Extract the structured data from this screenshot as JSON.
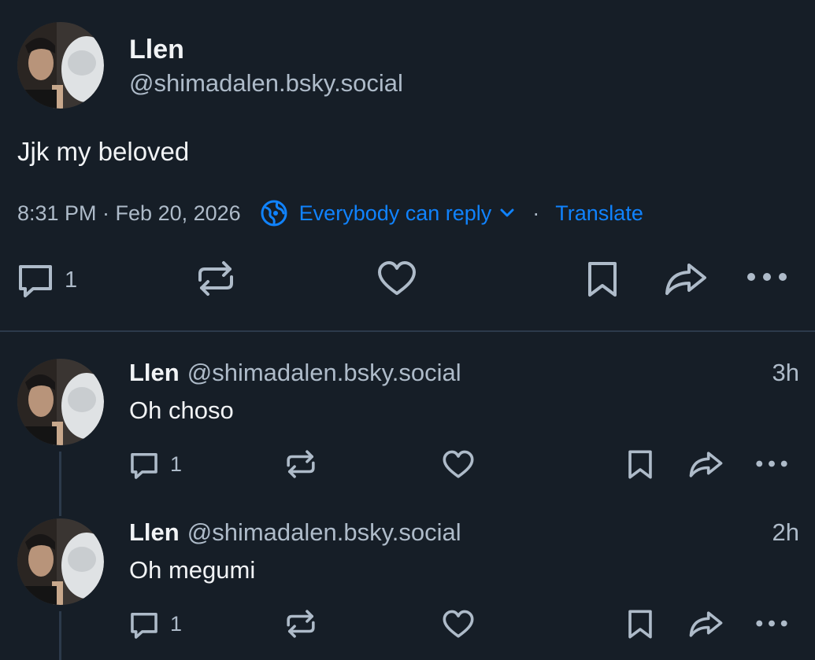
{
  "main_post": {
    "author_name": "Llen",
    "author_handle": "@shimadalen.bsky.social",
    "text": "Jjk my beloved",
    "timestamp": "8:31 PM · Feb 20, 2026",
    "reply_setting": "Everybody can reply",
    "separator": "·",
    "translate_label": "Translate",
    "reply_count": "1",
    "icons": [
      "reply-icon",
      "repost-icon",
      "like-icon",
      "bookmark-icon",
      "share-icon",
      "more-icon"
    ]
  },
  "replies": [
    {
      "author_name": "Llen",
      "author_handle": "@shimadalen.bsky.social",
      "time": "3h",
      "text": "Oh choso",
      "reply_count": "1"
    },
    {
      "author_name": "Llen",
      "author_handle": "@shimadalen.bsky.social",
      "time": "2h",
      "text": "Oh megumi",
      "reply_count": "1"
    }
  ],
  "colors": {
    "background": "#161e27",
    "text": "#f1f3f5",
    "muted": "#aebbc9",
    "accent": "#1083fe",
    "divider": "#2c3a4b"
  }
}
